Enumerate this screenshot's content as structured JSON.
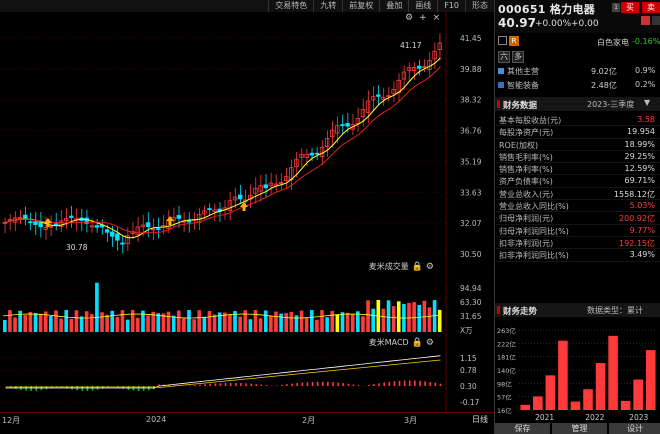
{
  "toolbar": {
    "items": [
      "交易特色",
      "九转",
      "前复权",
      "叠加",
      "画线",
      "F10",
      "形态"
    ]
  },
  "price_axis": [
    "41.45",
    "39.88",
    "38.32",
    "36.76",
    "35.19",
    "33.63",
    "32.07",
    "30.50"
  ],
  "price_marks": {
    "high_label": "41.17",
    "low_label": "30.78"
  },
  "volume": {
    "title": "麦米成交量",
    "axis": [
      "94.94",
      "63.30",
      "31.65",
      "X万"
    ]
  },
  "macd": {
    "title": "麦米MACD",
    "axis": [
      "1.15",
      "0.78",
      "0.30",
      "-0.17"
    ]
  },
  "xaxis": {
    "labels": [
      "12月",
      "2024",
      "2月",
      "3月"
    ],
    "day_button": "日线"
  },
  "stock": {
    "code_name": "000651 格力电器",
    "flag": "1",
    "buy": "买",
    "sell": "卖",
    "price": "40.97",
    "change": "+0.00%",
    "change_abs": "+0.00",
    "sector_name": "白色家电",
    "sector_pct": "-0.16%",
    "badge_r": "R"
  },
  "mini_tabs": [
    "六",
    "多"
  ],
  "segments": [
    {
      "name": "其他主营",
      "amount": "9.02亿",
      "pct": "0.9%",
      "color": "#4a8fd8"
    },
    {
      "name": "智能装备",
      "amount": "2.48亿",
      "pct": "0.2%",
      "color": "#3b6fc0"
    }
  ],
  "financial": {
    "title": "财务数据",
    "period": "2023-三季度",
    "rows": [
      {
        "label": "基本每股收益(元)",
        "value": "3.58",
        "color": "#ff3b3b"
      },
      {
        "label": "每股净资产(元)",
        "value": "19.954",
        "color": "#dddddd"
      },
      {
        "label": "ROE(加权)",
        "value": "18.99%",
        "color": "#dddddd"
      },
      {
        "label": "销售毛利率(%)",
        "value": "29.25%",
        "color": "#dddddd"
      },
      {
        "label": "销售净利率(%)",
        "value": "12.59%",
        "color": "#dddddd"
      },
      {
        "label": "资产负债率(%)",
        "value": "69.71%",
        "color": "#dddddd"
      },
      {
        "label": "营业总收入(元)",
        "value": "1558.12亿",
        "color": "#dddddd"
      },
      {
        "label": "营业总收入同比(%)",
        "value": "5.03%",
        "color": "#ff3b3b"
      },
      {
        "label": "归母净利润(元)",
        "value": "200.92亿",
        "color": "#ff3b3b"
      },
      {
        "label": "归母净利润同比(%)",
        "value": "9.77%",
        "color": "#ff3b3b"
      },
      {
        "label": "扣非净利润(元)",
        "value": "192.15亿",
        "color": "#ff3b3b"
      },
      {
        "label": "扣非净利润同比(%)",
        "value": "3.49%",
        "color": "#dddddd"
      }
    ]
  },
  "trend": {
    "title": "财务走势",
    "data_type": "数据类型：累计"
  },
  "chart_data": {
    "type": "bar",
    "title": "财务走势",
    "categories": [
      "2021",
      "2022",
      "2023"
    ],
    "yticks": [
      "263亿",
      "222亿",
      "181亿",
      "140亿",
      "98亿",
      "57亿",
      "16亿"
    ],
    "ylim": [
      16,
      263
    ],
    "values": [
      32,
      58,
      123,
      230,
      42,
      80,
      161,
      245,
      44,
      110,
      201
    ]
  },
  "bottom_bar": [
    "保存",
    "管理",
    "设计"
  ],
  "colors": {
    "up": "#ff3b3b",
    "down": "#00e0ff",
    "ma5": "#ffff33",
    "ma10": "#e02020"
  }
}
